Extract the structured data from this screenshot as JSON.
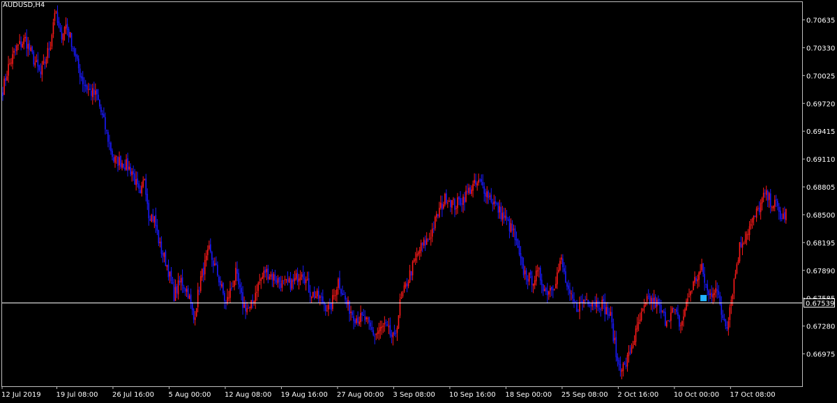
{
  "symbol_label": "AUDUSD,H4",
  "colors": {
    "background": "#000000",
    "frame": "#c0c0c0",
    "bull": "#ff1a1a",
    "bear": "#1a1aff",
    "price_line": "#ffffff",
    "text": "#ffffff",
    "marker": "#22b3ff"
  },
  "chart_data": {
    "type": "candlestick",
    "title": "AUDUSD,H4",
    "ylim": [
      0.6662,
      0.7083
    ],
    "y_ticks": [
      "0.70635",
      "0.70330",
      "0.70025",
      "0.69720",
      "0.69415",
      "0.69110",
      "0.68805",
      "0.68500",
      "0.68195",
      "0.67890",
      "0.67585",
      "0.67280",
      "0.66975"
    ],
    "x_ticks": [
      {
        "label": "12 Jul 2019",
        "bar": 0
      },
      {
        "label": "19 Jul 08:00",
        "bar": 39
      },
      {
        "label": "26 Jul 16:00",
        "bar": 79
      },
      {
        "label": "5 Aug 00:00",
        "bar": 119
      },
      {
        "label": "12 Aug 08:00",
        "bar": 159
      },
      {
        "label": "19 Aug 16:00",
        "bar": 199
      },
      {
        "label": "27 Aug 00:00",
        "bar": 239
      },
      {
        "label": "3 Sep 08:00",
        "bar": 279
      },
      {
        "label": "10 Sep 16:00",
        "bar": 319
      },
      {
        "label": "18 Sep 00:00",
        "bar": 359
      },
      {
        "label": "25 Sep 08:00",
        "bar": 399
      },
      {
        "label": "2 Oct 16:00",
        "bar": 439
      },
      {
        "label": "10 Oct 00:00",
        "bar": 479
      },
      {
        "label": "17 Oct 08:00",
        "bar": 519
      }
    ],
    "current_price": 0.67539,
    "current_price_label": "0.67539",
    "grid": false,
    "series": [
      {
        "key_points": [
          [
            0,
            0.6987
          ],
          [
            4,
            0.7012
          ],
          [
            10,
            0.7033
          ],
          [
            16,
            0.7042
          ],
          [
            22,
            0.702
          ],
          [
            27,
            0.7003
          ],
          [
            30,
            0.7018
          ],
          [
            34,
            0.7038
          ],
          [
            37,
            0.7074
          ],
          [
            41,
            0.7045
          ],
          [
            45,
            0.7058
          ],
          [
            49,
            0.704
          ],
          [
            53,
            0.7015
          ],
          [
            57,
            0.6996
          ],
          [
            62,
            0.6985
          ],
          [
            67,
            0.698
          ],
          [
            73,
            0.6945
          ],
          [
            79,
            0.691
          ],
          [
            85,
            0.6908
          ],
          [
            92,
            0.6898
          ],
          [
            98,
            0.6868
          ],
          [
            101,
            0.6892
          ],
          [
            104,
            0.6852
          ],
          [
            108,
            0.6845
          ],
          [
            112,
            0.6815
          ],
          [
            117,
            0.6795
          ],
          [
            122,
            0.6762
          ],
          [
            127,
            0.6778
          ],
          [
            132,
            0.6765
          ],
          [
            136,
            0.6735
          ],
          [
            141,
            0.678
          ],
          [
            147,
            0.681
          ],
          [
            153,
            0.6785
          ],
          [
            159,
            0.6752
          ],
          [
            166,
            0.6785
          ],
          [
            171,
            0.6752
          ],
          [
            176,
            0.6745
          ],
          [
            181,
            0.677
          ],
          [
            187,
            0.6788
          ],
          [
            193,
            0.6782
          ],
          [
            200,
            0.6773
          ],
          [
            207,
            0.6775
          ],
          [
            213,
            0.679
          ],
          [
            219,
            0.6765
          ],
          [
            226,
            0.6758
          ],
          [
            233,
            0.6745
          ],
          [
            239,
            0.6778
          ],
          [
            245,
            0.6752
          ],
          [
            251,
            0.6738
          ],
          [
            258,
            0.6735
          ],
          [
            265,
            0.6718
          ],
          [
            272,
            0.6728
          ],
          [
            279,
            0.6712
          ],
          [
            283,
            0.6752
          ],
          [
            290,
            0.6785
          ],
          [
            297,
            0.6812
          ],
          [
            304,
            0.6825
          ],
          [
            311,
            0.6855
          ],
          [
            316,
            0.687
          ],
          [
            322,
            0.686
          ],
          [
            328,
            0.6868
          ],
          [
            334,
            0.688
          ],
          [
            340,
            0.6885
          ],
          [
            346,
            0.6872
          ],
          [
            352,
            0.6858
          ],
          [
            358,
            0.6845
          ],
          [
            364,
            0.683
          ],
          [
            370,
            0.679
          ],
          [
            376,
            0.6778
          ],
          [
            382,
            0.6785
          ],
          [
            387,
            0.6765
          ],
          [
            393,
            0.6775
          ],
          [
            398,
            0.68
          ],
          [
            403,
            0.6762
          ],
          [
            409,
            0.6748
          ],
          [
            415,
            0.6758
          ],
          [
            421,
            0.6755
          ],
          [
            427,
            0.6752
          ],
          [
            433,
            0.6738
          ],
          [
            438,
            0.6688
          ],
          [
            443,
            0.6682
          ],
          [
            448,
            0.6705
          ],
          [
            454,
            0.6735
          ],
          [
            460,
            0.6758
          ],
          [
            466,
            0.6752
          ],
          [
            472,
            0.6735
          ],
          [
            478,
            0.6745
          ],
          [
            483,
            0.6728
          ],
          [
            488,
            0.6758
          ],
          [
            493,
            0.6778
          ],
          [
            498,
            0.679
          ],
          [
            503,
            0.676
          ],
          [
            508,
            0.6772
          ],
          [
            512,
            0.6742
          ],
          [
            516,
            0.673
          ],
          [
            520,
            0.6768
          ],
          [
            525,
            0.6815
          ],
          [
            530,
            0.683
          ],
          [
            535,
            0.6845
          ],
          [
            539,
            0.6858
          ],
          [
            543,
            0.6872
          ],
          [
            547,
            0.6865
          ],
          [
            551,
            0.686
          ],
          [
            555,
            0.6845
          ],
          [
            558,
            0.6852
          ]
        ]
      }
    ],
    "annotations": [
      {
        "type": "marker",
        "bar": 499,
        "price": 0.6759
      }
    ]
  }
}
